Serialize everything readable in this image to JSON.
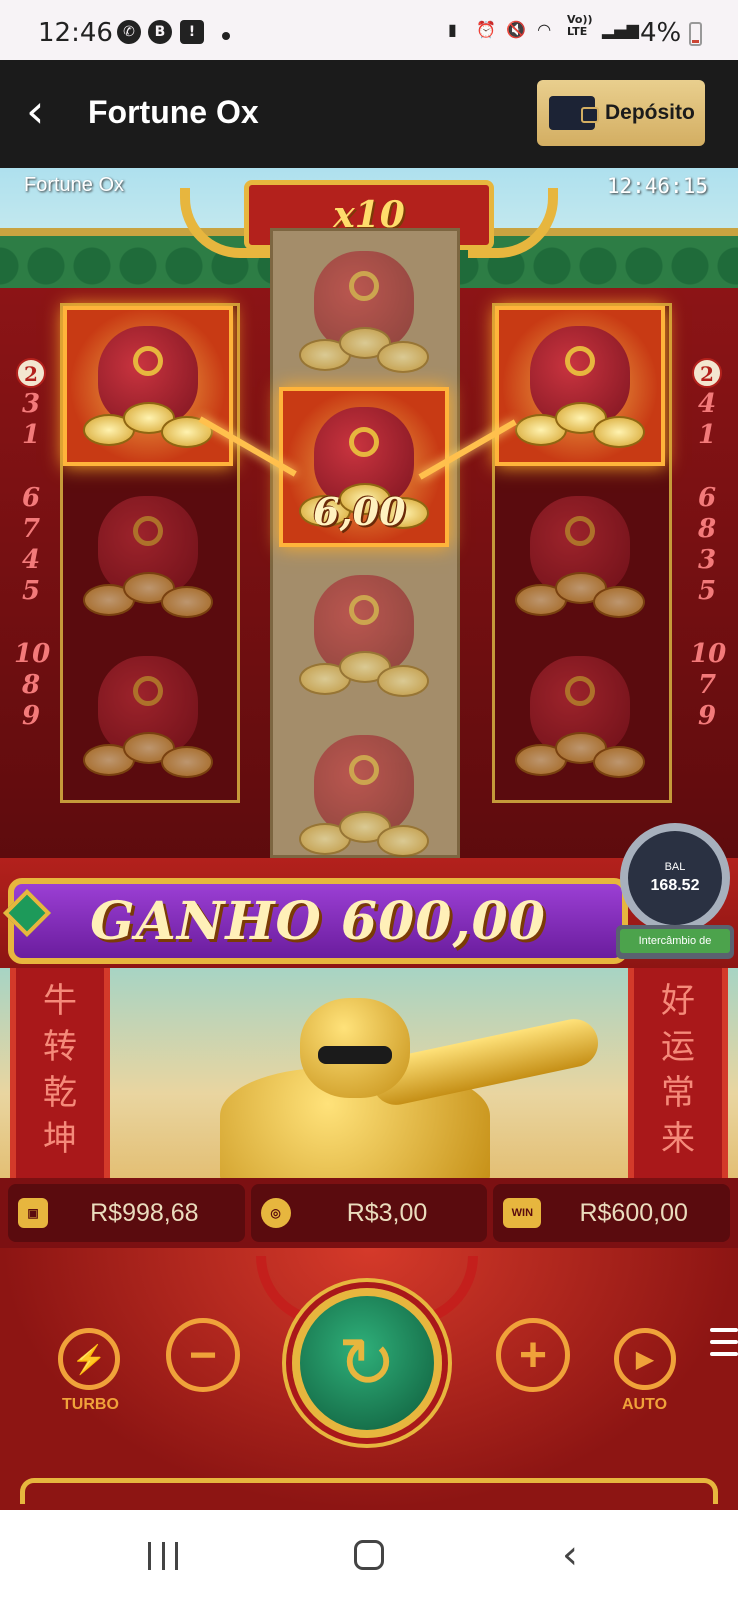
{
  "status_bar": {
    "time": "12:46",
    "battery_percent": "4%",
    "network": "LTE",
    "network_top": "Vo))",
    "left_icons": [
      "whatsapp-icon",
      "b-icon",
      "alert-icon",
      "dot"
    ],
    "right_icons": [
      "battery-saver-icon",
      "alarm-icon",
      "mute-icon",
      "wifi-icon",
      "signal-icon"
    ]
  },
  "app_bar": {
    "title": "Fortune Ox",
    "deposit_label": "Depósito"
  },
  "game": {
    "caption": "Fortune Ox",
    "clock": "12:46:15",
    "multiplier": "x10",
    "highlighted_cell_value": "6,00",
    "paylines_left": [
      "2",
      "3",
      "1",
      "6",
      "7",
      "4",
      "5",
      "10",
      "8",
      "9"
    ],
    "paylines_right": [
      "2",
      "4",
      "1",
      "6",
      "8",
      "3",
      "5",
      "10",
      "7",
      "9"
    ],
    "win_banner": "GANHO 600,00",
    "balance_widget": {
      "label": "BAL",
      "value": "168.52",
      "exchange_label": "Intercâmbio de"
    },
    "pillar_left": [
      "牛",
      "转",
      "乾",
      "坤"
    ],
    "pillar_right": [
      "好",
      "运",
      "常",
      "来"
    ],
    "stats": {
      "balance": "R$998,68",
      "bet": "R$3,00",
      "win": "R$600,00",
      "win_icon_text": "WIN"
    },
    "controls": {
      "turbo_label": "TURBO",
      "auto_label": "AUTO"
    },
    "colors": {
      "accent_gold": "#e7b63e",
      "banner_purple": "#9b3fd4",
      "game_red": "#8d1513",
      "spin_green": "#2fb07a"
    }
  }
}
